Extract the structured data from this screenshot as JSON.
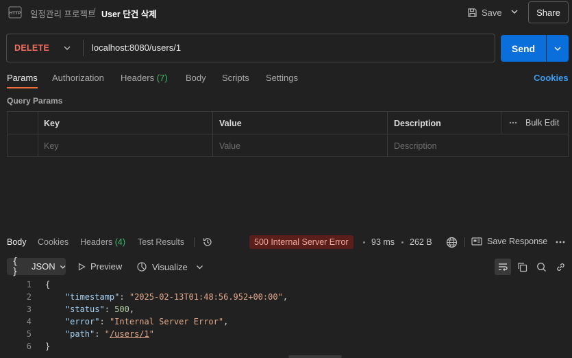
{
  "header": {
    "breadcrumb_collection": "일정관리 프로젝트",
    "breadcrumb_separator": "/",
    "request_title": "User 단건 삭제",
    "save_label": "Save",
    "share_label": "Share"
  },
  "request": {
    "method": "DELETE",
    "method_color": "#f56f5f",
    "url": "localhost:8080/users/1",
    "send_label": "Send"
  },
  "request_tabs": [
    {
      "label": "Params",
      "count": "",
      "active": true
    },
    {
      "label": "Authorization",
      "count": ""
    },
    {
      "label": "Headers",
      "count": "(7)"
    },
    {
      "label": "Body",
      "count": ""
    },
    {
      "label": "Scripts",
      "count": ""
    },
    {
      "label": "Settings",
      "count": ""
    }
  ],
  "cookies_link": "Cookies",
  "query_params": {
    "section_label": "Query Params",
    "columns": {
      "key": "Key",
      "value": "Value",
      "description": "Description"
    },
    "bulk_edit_label": "Bulk Edit",
    "placeholders": {
      "key": "Key",
      "value": "Value",
      "description": "Description"
    }
  },
  "response": {
    "tabs": [
      {
        "label": "Body",
        "count": "",
        "active": true
      },
      {
        "label": "Cookies",
        "count": ""
      },
      {
        "label": "Headers",
        "count": "(4)"
      },
      {
        "label": "Test Results",
        "count": ""
      }
    ],
    "status": "500 Internal Server Error",
    "status_color": "#5a1f1a",
    "time": "93 ms",
    "size": "262 B",
    "save_response_label": "Save Response",
    "format": "JSON",
    "preview_label": "Preview",
    "visualize_label": "Visualize",
    "body": {
      "line_numbers": [
        "1",
        "2",
        "3",
        "4",
        "5",
        "6"
      ],
      "open_brace": "{",
      "close_brace": "}",
      "timestamp_key": "\"timestamp\"",
      "timestamp_value": "\"2025-02-13T01:48:56.952+00:00\"",
      "status_key": "\"status\"",
      "status_value": "500",
      "error_key": "\"error\"",
      "error_value": "\"Internal Server Error\"",
      "path_key": "\"path\"",
      "path_value_quote": "\"",
      "path_value": "/users/1"
    }
  },
  "accent_colors": {
    "send_button": "#0a6edb",
    "active_tab_underline": "#f26b3a",
    "count_green": "#3ebd6e",
    "link_blue": "#3a9cf0"
  }
}
